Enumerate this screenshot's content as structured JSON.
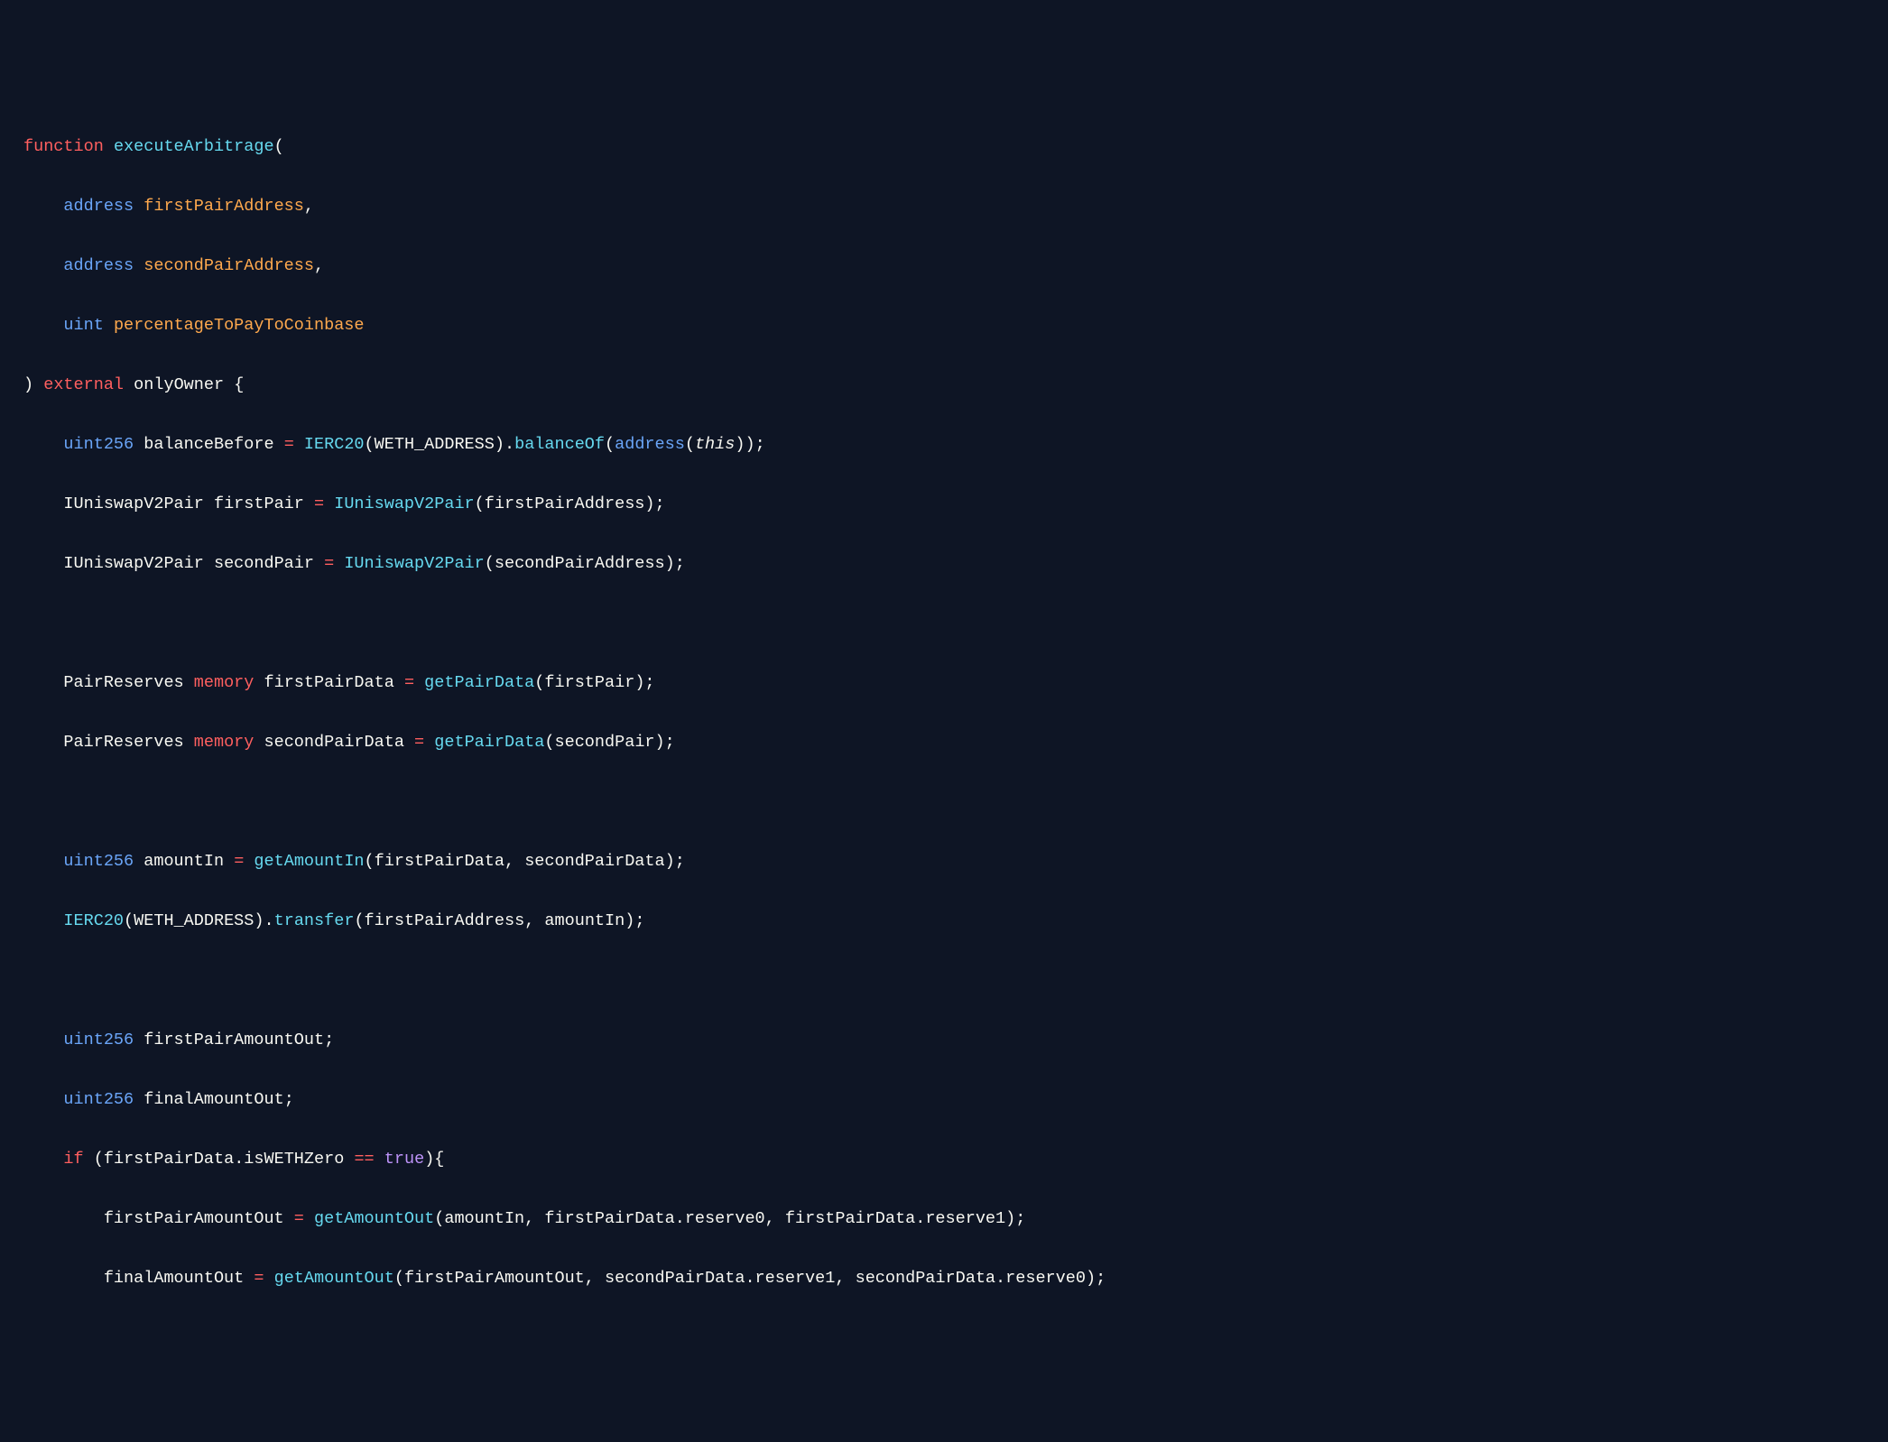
{
  "code": {
    "l1": {
      "kwFunction": "function",
      "fnName": "executeArbitrage",
      "open": "("
    },
    "l2": {
      "kwAddress": "address",
      "param": "firstPairAddress",
      "comma": ","
    },
    "l3": {
      "kwAddress": "address",
      "param": "secondPairAddress",
      "comma": ","
    },
    "l4": {
      "kwUint": "uint",
      "param": "percentageToPayToCoinbase"
    },
    "l5": {
      "close": ")",
      "kwExternal": "external",
      "modifier": "onlyOwner",
      "brace": "{"
    },
    "l6": {
      "kwUint256": "uint256",
      "var": "balanceBefore",
      "eq": "=",
      "typeIERC20": "IERC20",
      "open": "(",
      "constWeth": "WETH_ADDRESS",
      "close1": ").",
      "call": "balanceOf",
      "open2": "(",
      "kwAddress": "address",
      "open3": "(",
      "this": "this",
      "close3": "));"
    },
    "l7": {
      "type": "IUniswapV2Pair",
      "var": "firstPair",
      "eq": "=",
      "ctor": "IUniswapV2Pair",
      "open": "(",
      "arg": "firstPairAddress",
      "close": ");"
    },
    "l8": {
      "type": "IUniswapV2Pair",
      "var": "secondPair",
      "eq": "=",
      "ctor": "IUniswapV2Pair",
      "open": "(",
      "arg": "secondPairAddress",
      "close": ");"
    },
    "l10": {
      "type": "PairReserves",
      "kwMemory": "memory",
      "var": "firstPairData",
      "eq": "=",
      "call": "getPairData",
      "open": "(",
      "arg": "firstPair",
      "close": ");"
    },
    "l11": {
      "type": "PairReserves",
      "kwMemory": "memory",
      "var": "secondPairData",
      "eq": "=",
      "call": "getPairData",
      "open": "(",
      "arg": "secondPair",
      "close": ");"
    },
    "l13": {
      "kwUint256": "uint256",
      "var": "amountIn",
      "eq": "=",
      "call": "getAmountIn",
      "open": "(",
      "arg1": "firstPairData",
      "comma": ",",
      "arg2": "secondPairData",
      "close": ");"
    },
    "l14": {
      "typeIERC20": "IERC20",
      "open": "(",
      "constWeth": "WETH_ADDRESS",
      "close1": ").",
      "call": "transfer",
      "open2": "(",
      "arg1": "firstPairAddress",
      "comma": ",",
      "arg2": "amountIn",
      "close2": ");"
    },
    "l16": {
      "kwUint256": "uint256",
      "var": "firstPairAmountOut",
      "semi": ";"
    },
    "l17": {
      "kwUint256": "uint256",
      "var": "finalAmountOut",
      "semi": ";"
    },
    "l18": {
      "kwIf": "if",
      "open": "(",
      "obj": "firstPairData",
      "dot": ".",
      "prop": "isWETHZero",
      "eqeq": "==",
      "bool": "true",
      "close": "){"
    },
    "l19": {
      "var": "firstPairAmountOut",
      "eq": "=",
      "call": "getAmountOut",
      "open": "(",
      "arg1": "amountIn",
      "c1": ",",
      "arg2": "firstPairData",
      "d2": ".",
      "p2": "reserve0",
      "c2": ",",
      "arg3": "firstPairData",
      "d3": ".",
      "p3": "reserve1",
      "close": ");"
    },
    "l20": {
      "var": "finalAmountOut",
      "eq": "=",
      "call": "getAmountOut",
      "open": "(",
      "arg1": "firstPairAmountOut",
      "c1": ",",
      "arg2": "secondPairData",
      "d2": ".",
      "p2": "reserve1",
      "c2": ",",
      "arg3": "secondPairData",
      "d3": ".",
      "p3": "reserve0",
      "close": ");"
    }
  }
}
